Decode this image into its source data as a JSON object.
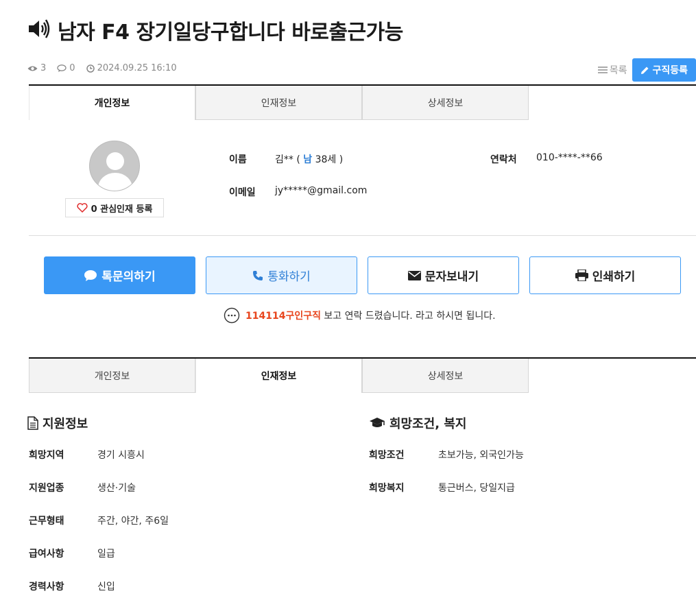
{
  "title": {
    "text": "남자 F4 장기일당구합니다 바로출근가능",
    "icon": "speaker-icon"
  },
  "meta": {
    "views": "3",
    "comments": "0",
    "datetime": "2024.09.25 16:10"
  },
  "toplinks": {
    "list_label": "목록",
    "register_label": "구직등록"
  },
  "tabs": [
    "개인정보",
    "인재정보",
    "상세정보"
  ],
  "profile": {
    "interest_label": "0 관심인재 등록",
    "name_label": "이름",
    "name_value": "김**",
    "name_open": "(",
    "gender": "남",
    "age": "38세",
    "name_close": ")",
    "contact_label": "연락처",
    "contact_value": "010-****-**66",
    "email_label": "이메일",
    "email_value": "jy*****@gmail.com"
  },
  "actions": {
    "chat": "톡문의하기",
    "call": "통화하기",
    "sms": "문자보내기",
    "print": "인쇄하기"
  },
  "notice": {
    "brand": "114114구인구직",
    "text": " 보고 연락 드렸습니다. 라고 하시면 됩니다."
  },
  "apply_info": {
    "title": "지원정보",
    "rows": [
      {
        "label": "희망지역",
        "value": "경기 시흥시"
      },
      {
        "label": "지원업종",
        "value": "생산·기술"
      },
      {
        "label": "근무형태",
        "value": "주간, 야간, 주6일"
      },
      {
        "label": "급여사항",
        "value": "일급"
      },
      {
        "label": "경력사항",
        "value": "신입"
      }
    ]
  },
  "conditions": {
    "title": "희망조건, 복지",
    "rows": [
      {
        "label": "희망조건",
        "value": "초보가능, 외국인가능"
      },
      {
        "label": "희망복지",
        "value": "통근버스, 당일지급"
      }
    ]
  },
  "colors": {
    "accent": "#3a98f5",
    "brand": "#e8451d",
    "gender": "#2f7fd6"
  }
}
